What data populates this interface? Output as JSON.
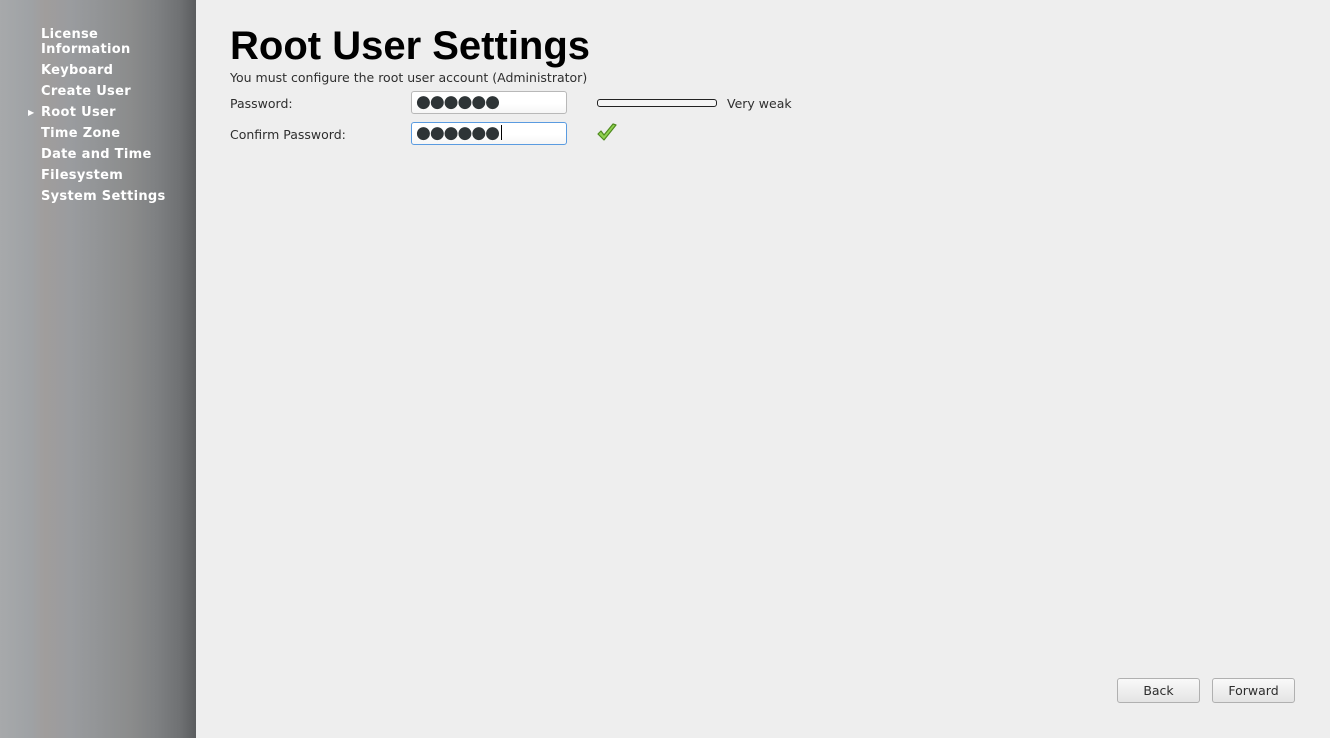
{
  "sidebar": {
    "current_index": 3,
    "items": [
      {
        "label": "License Information"
      },
      {
        "label": "Keyboard"
      },
      {
        "label": "Create User"
      },
      {
        "label": "Root User"
      },
      {
        "label": "Time Zone"
      },
      {
        "label": "Date and Time"
      },
      {
        "label": "Filesystem"
      },
      {
        "label": "System Settings"
      }
    ]
  },
  "main": {
    "title": "Root User Settings",
    "subtitle": "You must configure the root user account (Administrator)",
    "password_label": "Password:",
    "password_value": "●●●●●●",
    "confirm_label": "Confirm Password:",
    "confirm_value": "●●●●●●",
    "strength_label": "Very weak",
    "strength_percent": 0,
    "match_icon": "checkmark-icon",
    "match_color": "#7ac943"
  },
  "footer": {
    "back_label": "Back",
    "forward_label": "Forward"
  }
}
